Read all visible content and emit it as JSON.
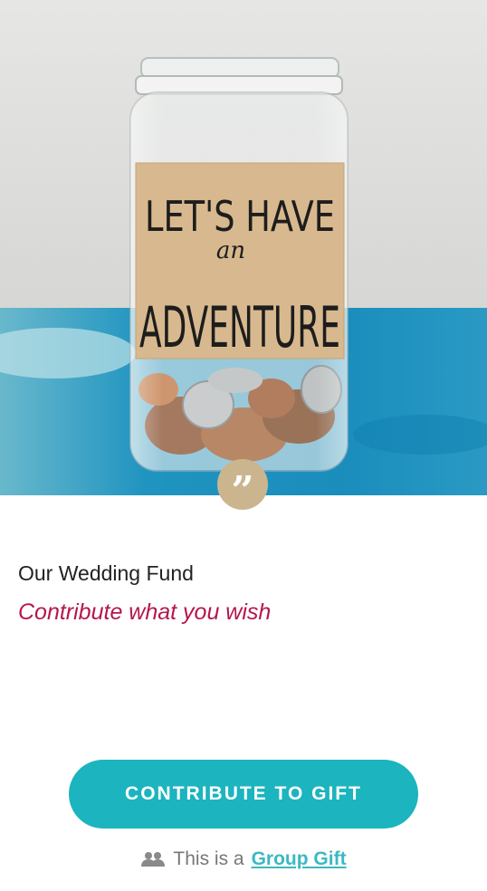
{
  "hero": {
    "jar_label_lines": [
      "LET'S HAVE",
      "an",
      "ADVENTURE"
    ]
  },
  "quote_icon": "quote-icon",
  "quote_glyph": "”",
  "fund": {
    "title": "Our Wedding Fund",
    "subtitle": "Contribute what you wish"
  },
  "cta": {
    "label": "CONTRIBUTE TO GIFT"
  },
  "group": {
    "icon": "group-icon",
    "prefix": "This is a",
    "link": "Group Gift"
  },
  "colors": {
    "accent": "#1bb4bf",
    "subtitle": "#b5174a",
    "badge": "#cbb58f",
    "link": "#3cb8c2"
  }
}
